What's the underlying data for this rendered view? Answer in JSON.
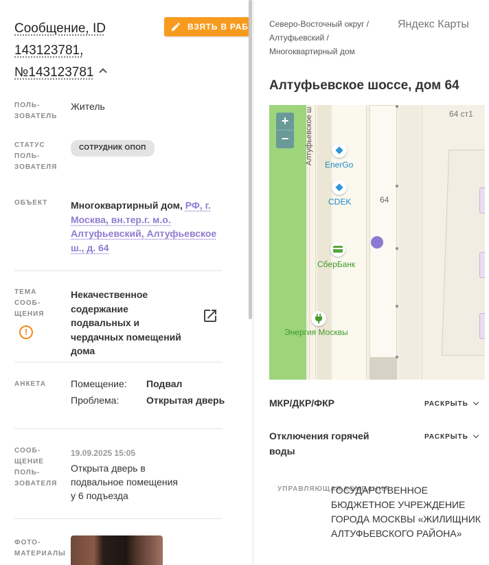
{
  "message": {
    "title": "Сообщение, ID 143123781, №143123781",
    "take_button": "ВЗЯТЬ В РАБОТУ"
  },
  "fields": {
    "user_label": "ПОЛЬ-ЗОВАТЕЛЬ",
    "user_value": "Житель",
    "status_label": "СТАТУС ПОЛЬ-ЗОВАТЕЛЯ",
    "status_value": "СОТРУДНИК ОПОП",
    "object_label": "ОБЪЕКТ",
    "object_type": "Многоквартирный дом,",
    "object_address": "РФ, г. Москва, вн.тер.г. м.о. Алтуфьевский, Алтуфьевское ш., д. 64",
    "topic_label": "ТЕМА СООБ-ЩЕНИЯ",
    "topic_value": "Некачественное содержание подвальных и чердачных помещений дома",
    "form_label": "АНКЕТА",
    "form_rows": [
      {
        "key": "Помещение:",
        "value": "Подвал"
      },
      {
        "key": "Проблема:",
        "value": "Открытая дверь"
      }
    ],
    "user_msg_label": "СООБ-ЩЕНИЕ ПОЛЬ-ЗОВАТЕЛЯ",
    "user_msg_date": "19.09.2025 15:05",
    "user_msg_text": "Открыта дверь в подвальное помещения у 6 подъезда",
    "photos_label": "ФОТО-МАТЕРИАЛЫ"
  },
  "right": {
    "breadcrumb": "Северо-Восточный округ / Алтуфьевский / Многоквартирный дом",
    "yandex_maps_link": "Яндекс Карты",
    "address_title": "Алтуфьевское шоссе, дом 64",
    "map": {
      "zoom_in": "+",
      "zoom_out": "−",
      "street_label": "Алтуфьевское ш",
      "building_label": "64",
      "building_label_2": "64 ст1",
      "poi": [
        {
          "name": "EnerGo",
          "color": "#1a8ac8",
          "icon": "diamond-icon"
        },
        {
          "name": "CDEK",
          "color": "#1a8ac8",
          "icon": "diamond-icon"
        },
        {
          "name": "СберБанк",
          "color": "#3c9a2a",
          "icon": "bank-card-icon"
        },
        {
          "name": "Энергия Москвы",
          "color": "#3c9a2a",
          "icon": "plug-icon"
        }
      ]
    },
    "sections": [
      {
        "title": "МКР/ДКР/ФКР",
        "action": "РАСКРЫТЬ"
      },
      {
        "title": "Отключения горячей воды",
        "action": "РАСКРЫТЬ"
      }
    ],
    "management_label": "УПРАВЛЯЮЩАЯ КОМПАНИЯ",
    "management_value": "ГОСУДАРСТВЕННОЕ БЮДЖЕТНОЕ УЧРЕЖДЕНИЕ ГОРОДА МОСКВЫ «ЖИЛИЩНИК АЛТУФЬЕВСКОГО РАЙОНА»"
  },
  "colors": {
    "accent_orange": "#f79b1e",
    "link_purple": "#8e7bd0"
  }
}
